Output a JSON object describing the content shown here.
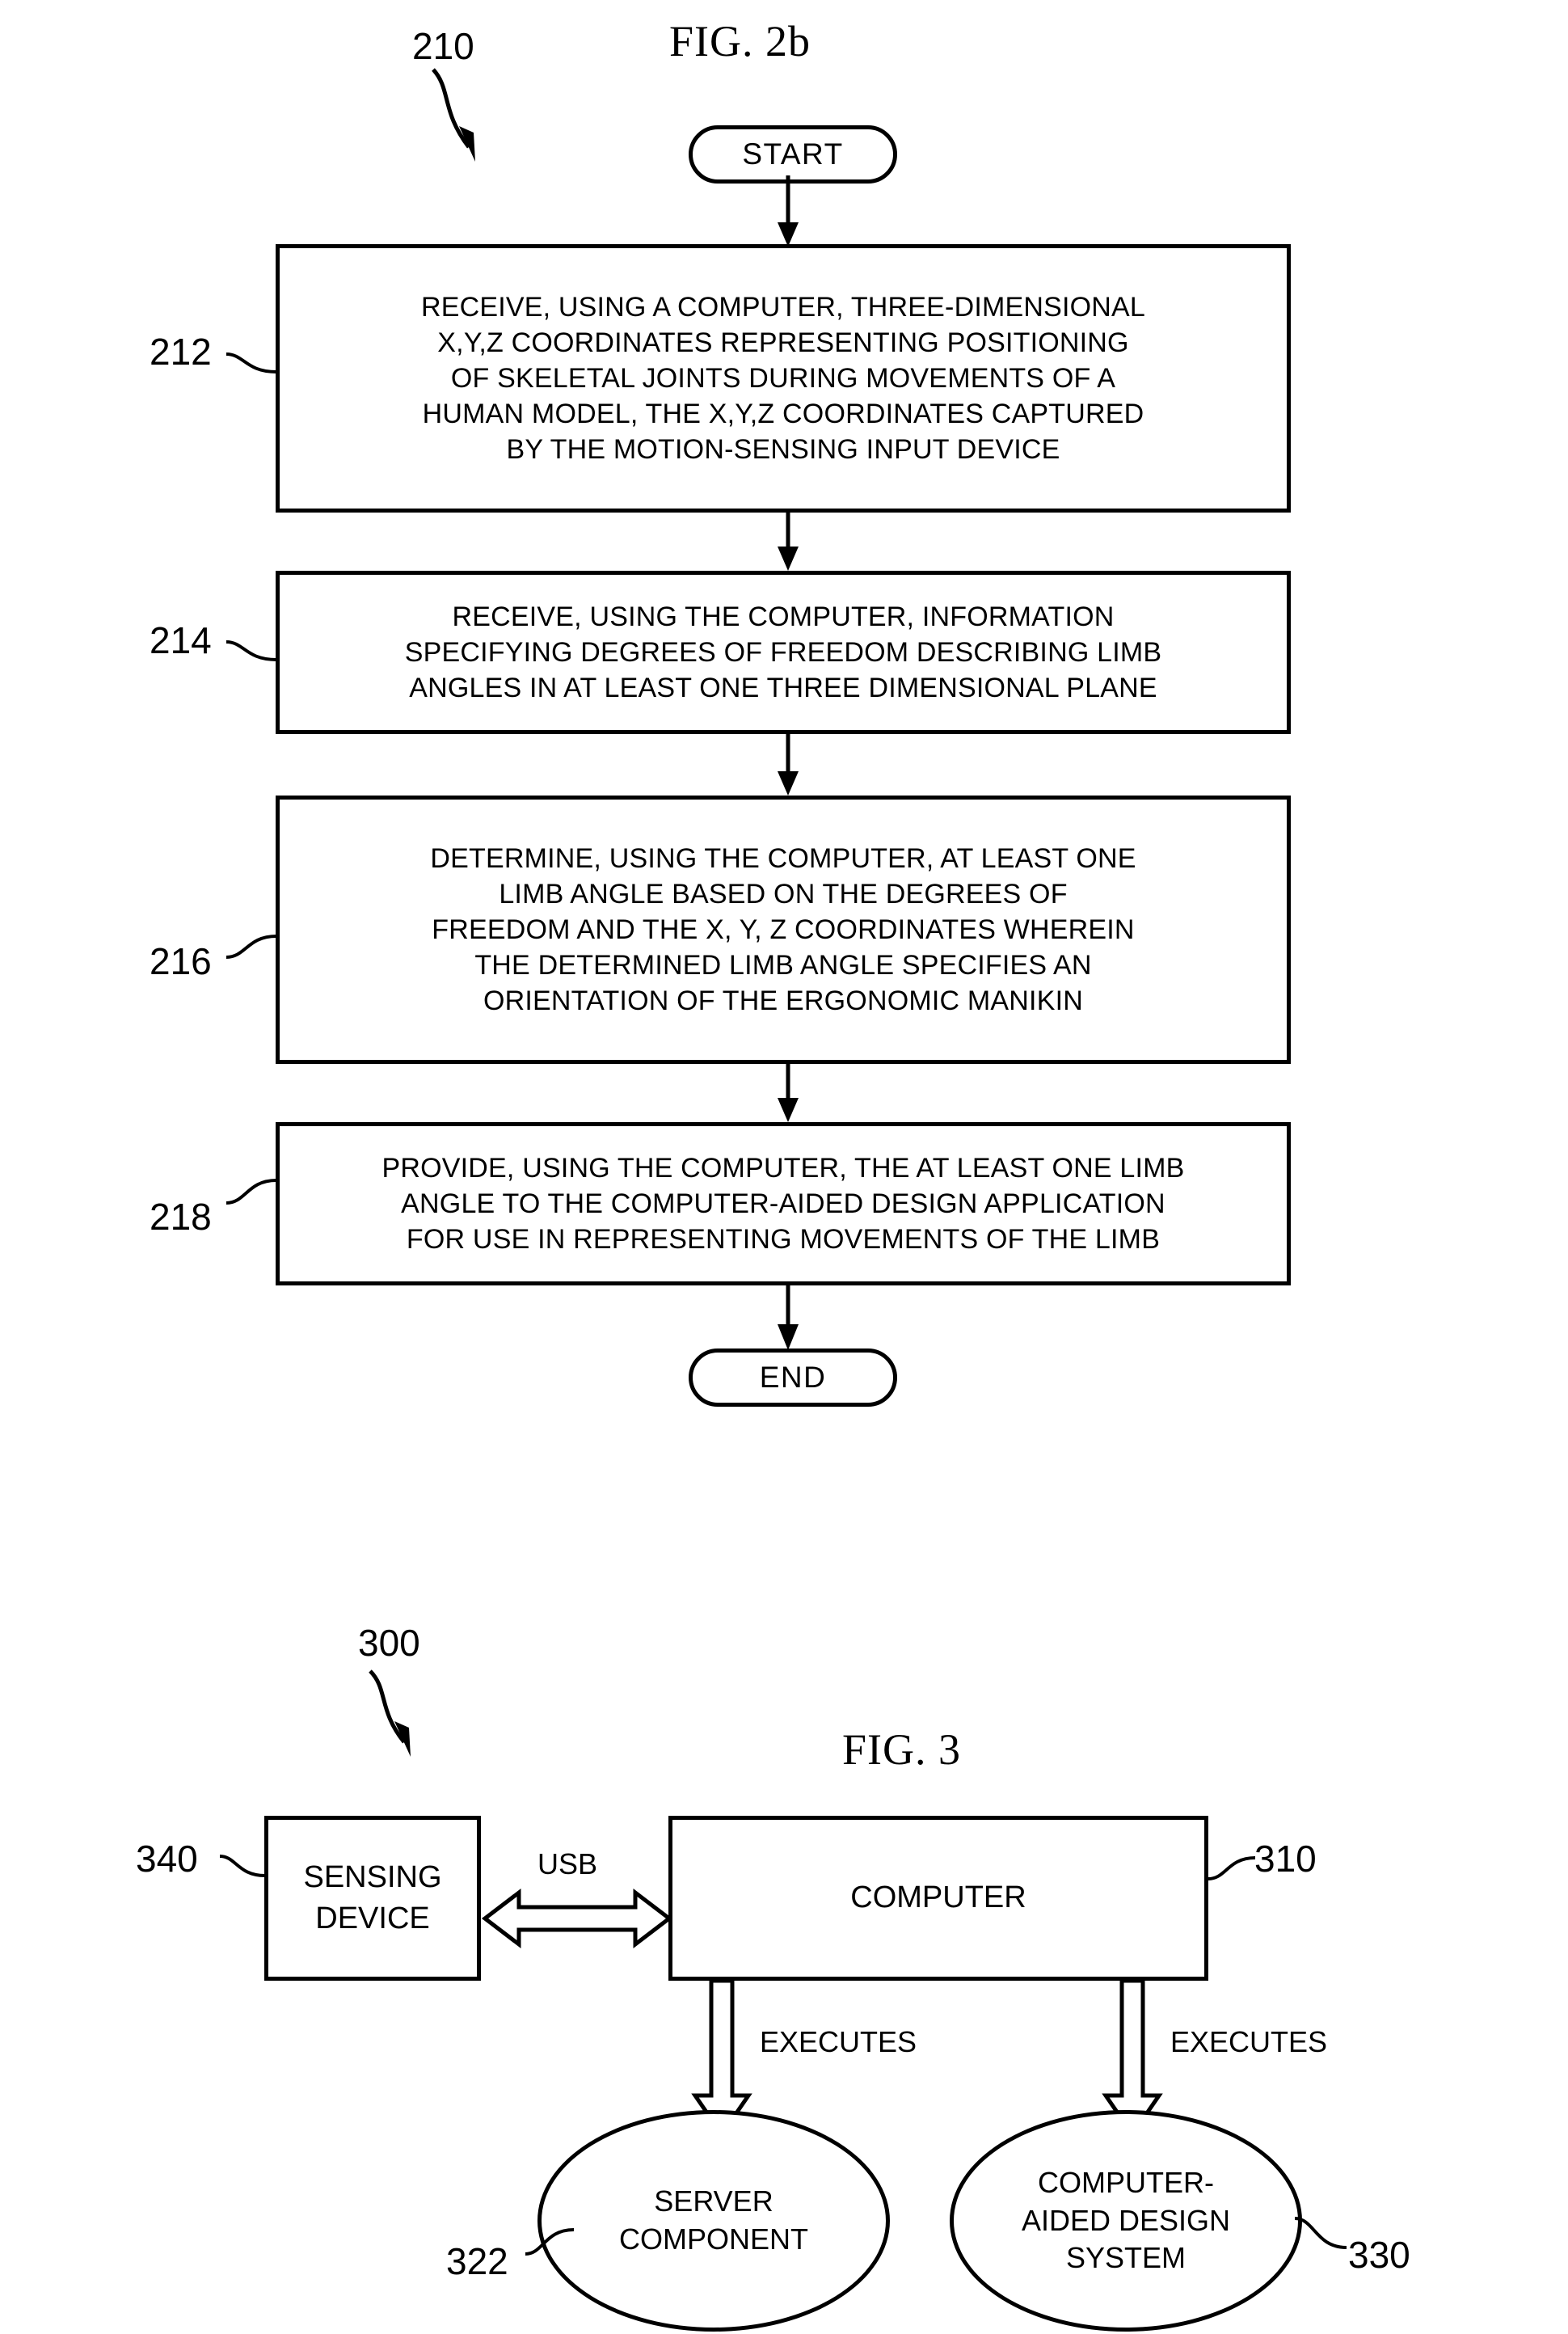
{
  "figures": {
    "fig2b": {
      "title": "FIG. 2b",
      "flow_ref": "210",
      "start_label": "START",
      "end_label": "END",
      "steps": [
        {
          "ref": "212",
          "text": "RECEIVE, USING A COMPUTER, THREE-DIMENSIONAL\nX,Y,Z COORDINATES REPRESENTING POSITIONING\nOF SKELETAL JOINTS DURING MOVEMENTS OF A\nHUMAN MODEL, THE X,Y,Z COORDINATES CAPTURED\nBY THE MOTION-SENSING INPUT DEVICE"
        },
        {
          "ref": "214",
          "text": "RECEIVE, USING THE COMPUTER, INFORMATION\nSPECIFYING DEGREES OF FREEDOM DESCRIBING LIMB\nANGLES IN AT LEAST ONE THREE DIMENSIONAL PLANE"
        },
        {
          "ref": "216",
          "text": "DETERMINE, USING THE COMPUTER, AT LEAST ONE\nLIMB ANGLE BASED ON THE DEGREES OF\nFREEDOM AND THE X, Y, Z COORDINATES WHEREIN\nTHE DETERMINED LIMB ANGLE SPECIFIES AN\nORIENTATION OF THE ERGONOMIC MANIKIN"
        },
        {
          "ref": "218",
          "text": "PROVIDE, USING THE COMPUTER, THE AT LEAST ONE LIMB\nANGLE TO THE COMPUTER-AIDED DESIGN APPLICATION\nFOR USE IN REPRESENTING MOVEMENTS OF THE LIMB"
        }
      ]
    },
    "fig3": {
      "title": "FIG. 3",
      "system_ref": "300",
      "nodes": {
        "sensing_device": {
          "ref": "340",
          "label": "SENSING\nDEVICE"
        },
        "computer": {
          "ref": "310",
          "label": "COMPUTER"
        },
        "server_component": {
          "ref": "322",
          "label": "SERVER\nCOMPONENT"
        },
        "cad_system": {
          "ref": "330",
          "label": "COMPUTER-\nAIDED DESIGN\nSYSTEM"
        }
      },
      "connections": {
        "usb_label": "USB",
        "executes_left_label": "EXECUTES",
        "executes_right_label": "EXECUTES"
      }
    }
  },
  "colors": {
    "ink": "#000000",
    "paper": "#ffffff"
  }
}
